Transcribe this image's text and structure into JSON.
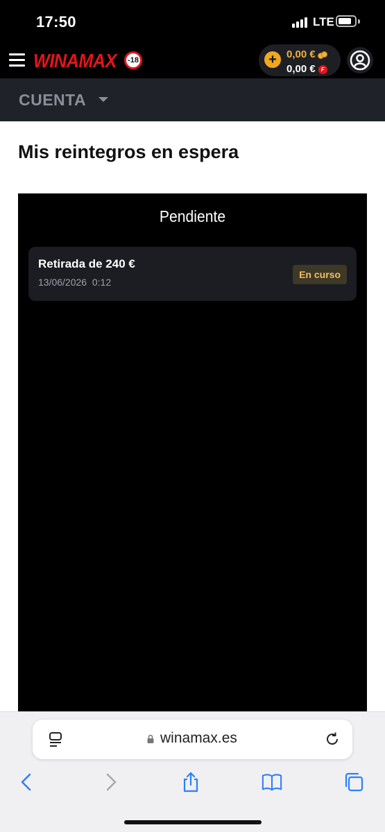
{
  "status_bar": {
    "time": "17:50",
    "network": "LTE",
    "icons": [
      "signal-bars-icon",
      "battery-icon"
    ]
  },
  "header": {
    "brand": "WINAMAX",
    "age_badge": "-18",
    "wallet": {
      "cash_balance": "0,00 €",
      "bonus_balance": "0,00 €",
      "icons": [
        "add-funds-icon",
        "coins-icon",
        "freebet-icon"
      ]
    },
    "icons": [
      "menu-icon",
      "account-icon"
    ]
  },
  "section": {
    "title": "CUENTA",
    "icon": "chevron-down-icon"
  },
  "page": {
    "title": "Mis reintegros en espera",
    "panel": {
      "title": "Pendiente",
      "withdrawals": [
        {
          "label": "Retirada de 240 €",
          "date": "13/06/2026",
          "time": "0:12",
          "status": "En curso"
        }
      ]
    }
  },
  "browser": {
    "url": "winamax.es",
    "icons": [
      "reader-mode-icon",
      "lock-icon",
      "reload-icon",
      "back-icon",
      "forward-icon",
      "share-icon",
      "bookmarks-icon",
      "tabs-icon"
    ],
    "colors": {
      "accent": "#2f7ef6",
      "disabled": "#a8a8ad"
    }
  },
  "colors": {
    "brand_red": "#e5141c",
    "gold": "#f0b040",
    "status_badge_text": "#f0c060"
  }
}
